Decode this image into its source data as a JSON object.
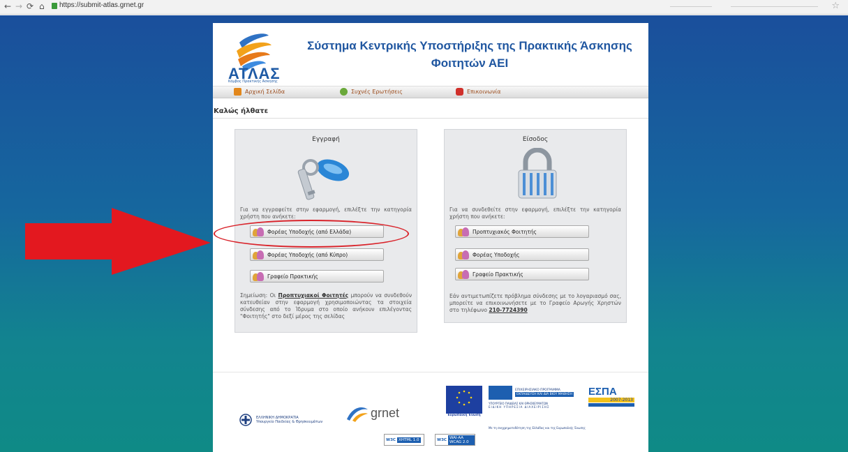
{
  "browser": {
    "url": "https://submit-atlas.grnet.gr"
  },
  "site": {
    "logo_text": "ΑΤΛΑΣ",
    "logo_subtext": "Κόμβος Πρακτικής Άσκησης",
    "title_line1": "Σύστημα Κεντρικής Υποστήριξης της Πρακτικής Άσκησης",
    "title_line2": "Φοιτητών ΑΕΙ"
  },
  "menu": {
    "home": "Αρχική Σελίδα",
    "faq": "Συχνές Ερωτήσεις",
    "contact": "Επικοινωνία"
  },
  "welcome": "Καλώς ήλθατε",
  "register": {
    "title": "Εγγραφή",
    "instruction": "Για να εγγραφείτε στην εφαρμογή, επιλέξτε την κατηγορία χρήστη που ανήκετε:",
    "buttons": [
      "Φορέας Υποδοχής (από Ελλάδα)",
      "Φορέας Υποδοχής (από Κύπρο)",
      "Γραφείο Πρακτικής"
    ],
    "note_prefix": "Σημείωση: Οι",
    "note_bold": "Προπτυχιακοί Φοιτητές",
    "note_rest": "μπορούν να συνδεθούν κατευθείαν στην εφαρμογή χρησιμοποιώντας τα στοιχεία σύνδεσης από το Ίδρυμα στο οποίο ανήκουν επιλέγοντας \"Φοιτητής\" στο δεξί μέρος της σελίδας"
  },
  "login": {
    "title": "Είσοδος",
    "instruction": "Για να συνδεθείτε στην εφαρμογή, επιλέξτε την κατηγορία χρήστη που ανήκετε:",
    "buttons": [
      "Προπτυχιακός Φοιτητής",
      "Φορέας Υποδοχής",
      "Γραφείο Πρακτικής"
    ],
    "note": "Εάν αντιμετωπίζετε πρόβλημα σύνδεσης με το λογαριασμό σας, μπορείτε να επικοινωνήσετε με το Γραφείο Αρωγής Χρηστών στο τηλέφωνο",
    "phone": "210-7724390"
  },
  "footer": {
    "ministry_line1": "ΕΛΛΗΝΙΚΗ ΔΗΜΟΚΡΑΤΙΑ",
    "ministry_line2": "Υπουργείο Παιδείας & Θρησκευμάτων",
    "grnet": "grnet",
    "eu_label": "Ευρωπαϊκή Ένωση",
    "program_line1": "ΕΠΙΧΕΙΡΗΣΙΑΚΟ ΠΡΟΓΡΑΜΜΑ",
    "program_line2": "ΕΚΠΑΙΔΕΥΣΗ ΚΑΙ ΔΙΑ ΒΙΟΥ ΜΑΘΗΣΗ",
    "ministry_line3": "ΥΠΟΥΡΓΕΙΟ ΠΑΙΔΕΙΑΣ ΚΑΙ ΘΡΗΣΚΕΥΜΑΤΩΝ",
    "ministry_line4": "ΕΙΔΙΚΗ ΥΠΗΡΕΣΙΑ ΔΙΑΧΕΙΡΙΣΗΣ",
    "cofund": "Με τη συγχρηματοδότηση της Ελλάδας και της Ευρωπαϊκής Ένωσης",
    "espa": "ΕΣΠΑ",
    "espa_years": "2007-2013",
    "w3c_xhtml": "XHTML 1.0",
    "w3c_wai": "WAI-AA WCAG 2.0",
    "w3c": "W3C"
  }
}
